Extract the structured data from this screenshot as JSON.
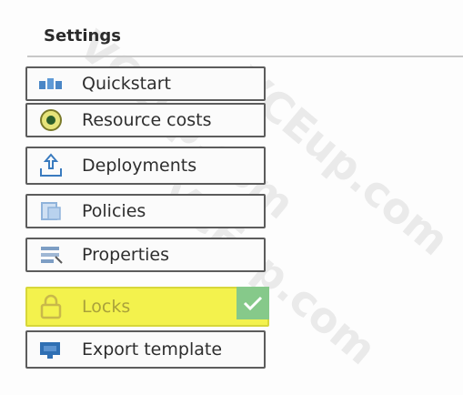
{
  "panel": {
    "title": "Settings"
  },
  "menu": {
    "items": [
      {
        "label": "Quickstart",
        "icon": "quickstart-icon"
      },
      {
        "label": "Resource costs",
        "icon": "resource-costs-icon"
      },
      {
        "label": "Deployments",
        "icon": "deployments-icon"
      },
      {
        "label": "Policies",
        "icon": "policies-icon"
      },
      {
        "label": "Properties",
        "icon": "properties-icon"
      },
      {
        "label": "Locks",
        "icon": "lock-icon",
        "selected": true
      },
      {
        "label": "Export template",
        "icon": "export-template-icon"
      }
    ]
  },
  "colors": {
    "highlight": "#f3f24d",
    "check": "#86c98a",
    "border": "#5c5c5c"
  },
  "watermark": {
    "text": "VCEup.com"
  }
}
